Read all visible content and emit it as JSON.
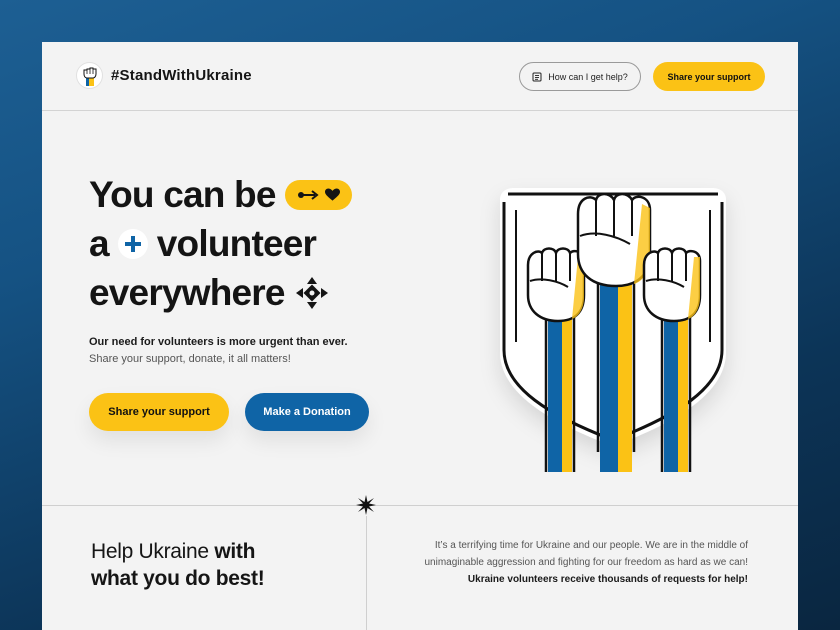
{
  "header": {
    "brand": "#StandWithUkraine",
    "help_label": "How can I get help?",
    "share_label": "Share your support"
  },
  "hero": {
    "line1": "You can be",
    "line2a": "a",
    "line2b": "volunteer",
    "line3": "everywhere",
    "subtitle_bold": "Our need for volunteers is more urgent than ever.",
    "subtitle": "Share your support, donate, it all matters!",
    "cta_primary": "Share your support",
    "cta_secondary": "Make a Donation"
  },
  "icons": {
    "logo": "raised-fist-icon",
    "help": "document-icon",
    "pill": [
      "arrow-key-icon",
      "heart-icon"
    ],
    "plus": "plus-icon",
    "everywhere": "four-arrows-icon",
    "divider": "asterisk-star-icon"
  },
  "section": {
    "title_regular": "Help Ukraine",
    "title_bold_1": "with",
    "title_bold_2": "what you do best!",
    "paragraph": "It’s a terrifying time for Ukraine and our people. We are in the middle of unimaginable aggression and fighting for our freedom as hard as we can!",
    "paragraph_bold": "Ukraine volunteers receive thousands of requests for help!"
  },
  "colors": {
    "yellow": "#fbc215",
    "blue": "#0f64a6",
    "ink": "#141414",
    "background": "#f3f3f3"
  }
}
